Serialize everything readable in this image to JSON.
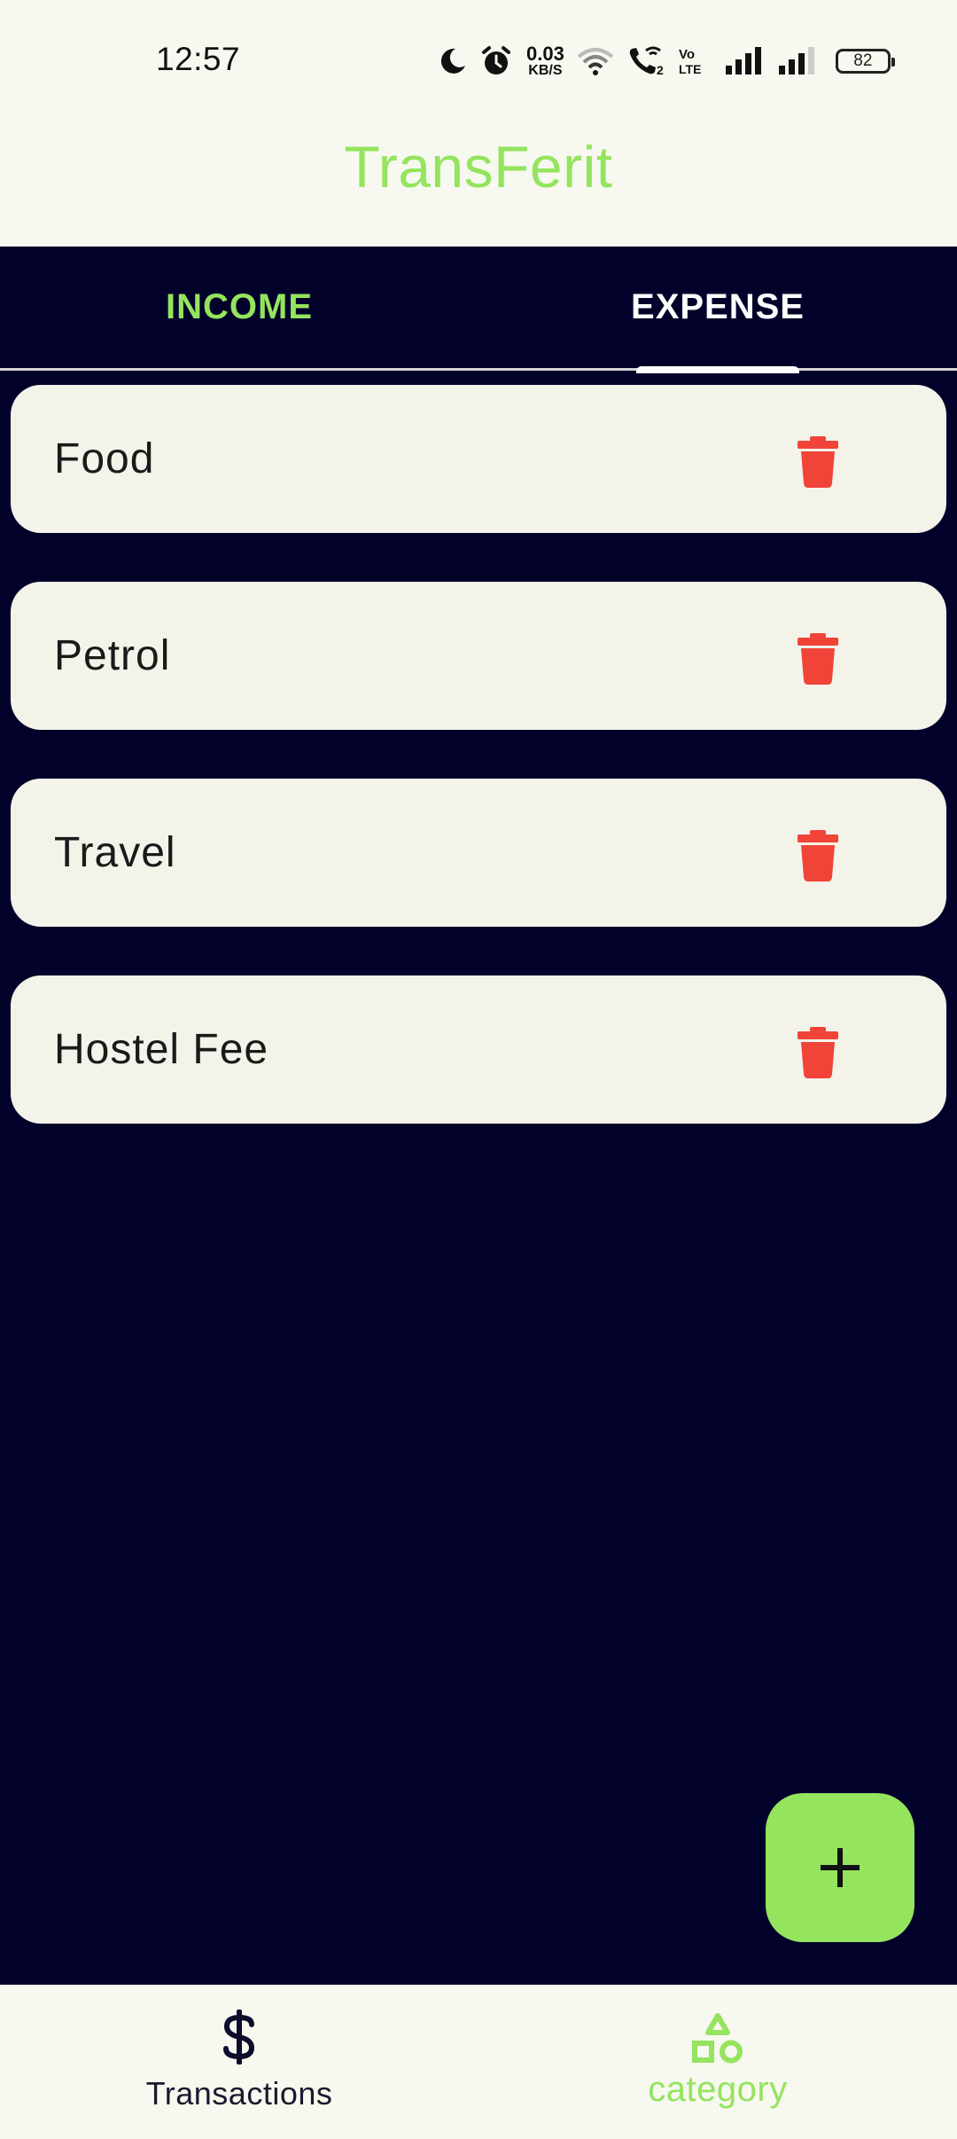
{
  "status_bar": {
    "time": "12:57",
    "net_speed_value": "0.03",
    "net_speed_unit": "KB/S",
    "battery": "82",
    "icons": [
      "moon-icon",
      "alarm-icon",
      "wifi-icon",
      "wifi-call-icon",
      "volte-icon",
      "signal-icon",
      "signal-icon",
      "battery-icon"
    ]
  },
  "app": {
    "title": "TransFerit"
  },
  "tabs": [
    {
      "label": "INCOME",
      "active": false
    },
    {
      "label": "EXPENSE",
      "active": true
    }
  ],
  "categories": [
    {
      "label": "Food"
    },
    {
      "label": "Petrol"
    },
    {
      "label": "Travel"
    },
    {
      "label": "Hostel Fee"
    }
  ],
  "fab": {
    "icon": "plus-icon"
  },
  "bottom_nav": [
    {
      "label": "Transactions",
      "icon": "dollar-icon",
      "active": false
    },
    {
      "label": "category",
      "icon": "shapes-icon",
      "active": true
    }
  ],
  "colors": {
    "accent": "#94E45E",
    "background": "#02012A",
    "surface": "#F7F8EF",
    "card": "#F3F3EA",
    "delete": "#F04438"
  }
}
